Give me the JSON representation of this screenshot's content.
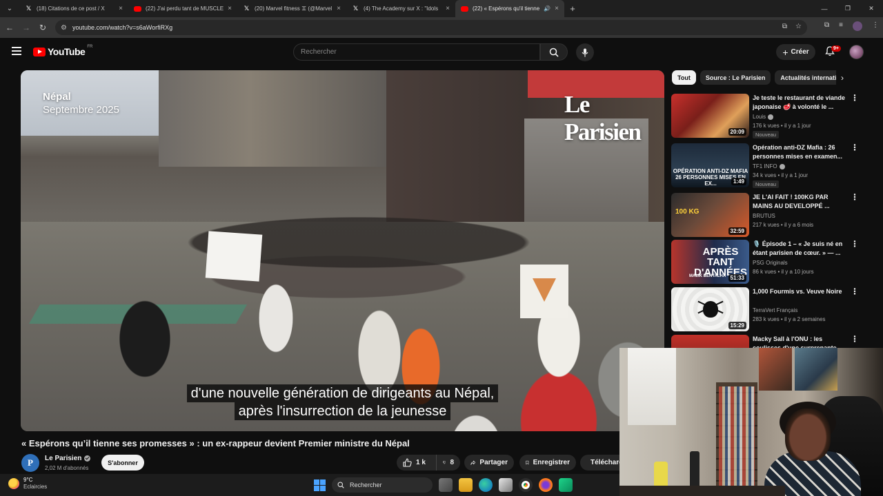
{
  "browser": {
    "tabs": [
      {
        "icon": "x-icon",
        "title": "(18) Citations de ce post / X",
        "active": false
      },
      {
        "icon": "youtube-icon",
        "title": "(22) J'ai perdu tant de MUSCLE",
        "active": false
      },
      {
        "icon": "x-icon",
        "title": "(20) Marvel fitness ♊ (@Marvel",
        "active": false
      },
      {
        "icon": "x-icon",
        "title": "(4) The Academy sur X : \"Idols",
        "active": false
      },
      {
        "icon": "youtube-icon",
        "title": "(22) « Espérons qu'il tienne",
        "active": true
      }
    ],
    "url": "youtube.com/watch?v=s6aWorfiRXg"
  },
  "youtube": {
    "logo_text": "YouTube",
    "country_code": "FR",
    "search_placeholder": "Rechercher",
    "create_label": "Créer",
    "notifications_badge": "9+"
  },
  "video": {
    "overlay_place": "Népal",
    "overlay_date": "Septembre 2025",
    "brand": "Le Parisien",
    "subtitle_line1": "d'une nouvelle génération de dirigeants au Népal,",
    "subtitle_line2": "après l'insurrection de la jeunesse",
    "title": "« Espérons qu’il tienne ses promesses » : un ex-rappeur devient Premier ministre du Népal",
    "channel_initial": "P",
    "channel_name": "Le Parisien",
    "channel_subs": "2,02 M d'abonnés",
    "subscribe_label": "S'abonner",
    "likes": "1 k",
    "dislikes": "8",
    "share_label": "Partager",
    "save_label": "Enregistrer",
    "download_label": "Télécharger"
  },
  "sidebar": {
    "chips": [
      "Tout",
      "Source : Le Parisien",
      "Actualités internationales"
    ],
    "items": [
      {
        "title": "Je teste le restaurant de viande japonaise 🥩 à volonté le ...",
        "channel": "Louis",
        "verified": true,
        "meta": "176 k vues • il y a 1 jour",
        "badge": "Nouveau",
        "duration": "20:09"
      },
      {
        "title": "Opération anti-DZ Mafia : 26 personnes mises en examen...",
        "channel": "TF1 INFO",
        "verified": true,
        "meta": "34 k vues • il y a 1 jour",
        "badge": "Nouveau",
        "duration": "1:49",
        "thumb_text": "OPÉRATION ANTI-DZ MAFIA 26 PERSONNES MISES EN EX..."
      },
      {
        "title": "JE L'AI FAIT ! 100KG PAR MAINS AU DEVELOPPÉ ...",
        "channel": "BRUTUS",
        "verified": false,
        "meta": "217 k vues • il y a 6 mois",
        "badge": "",
        "duration": "32:59",
        "thumb_text": "100 KG"
      },
      {
        "title": "🎙️ Épisode 1 – « Je suis né en étant parisien de cœur. » — ...",
        "channel": "PSG Originals",
        "verified": false,
        "meta": "86 k vues • il y a 10 jours",
        "badge": "",
        "duration": "51:33",
        "thumb_text": "APRÈS TANT D'ANNÉES",
        "thumb_sub": "MALIK BENTALHA"
      },
      {
        "title": "1,000 Fourmis vs. Veuve Noire",
        "channel": "TerraVert Français",
        "verified": false,
        "meta": "283 k vues • il y a 2 semaines",
        "badge": "",
        "duration": "15:29"
      },
      {
        "title": "Macky Sall à l'ONU : les coulisses d'une surprenante ...",
        "channel": "",
        "verified": false,
        "meta": "",
        "badge": "",
        "duration": ""
      }
    ]
  },
  "taskbar": {
    "temperature": "9°C",
    "condition": "Eclaircies",
    "search_label": "Rechercher"
  }
}
